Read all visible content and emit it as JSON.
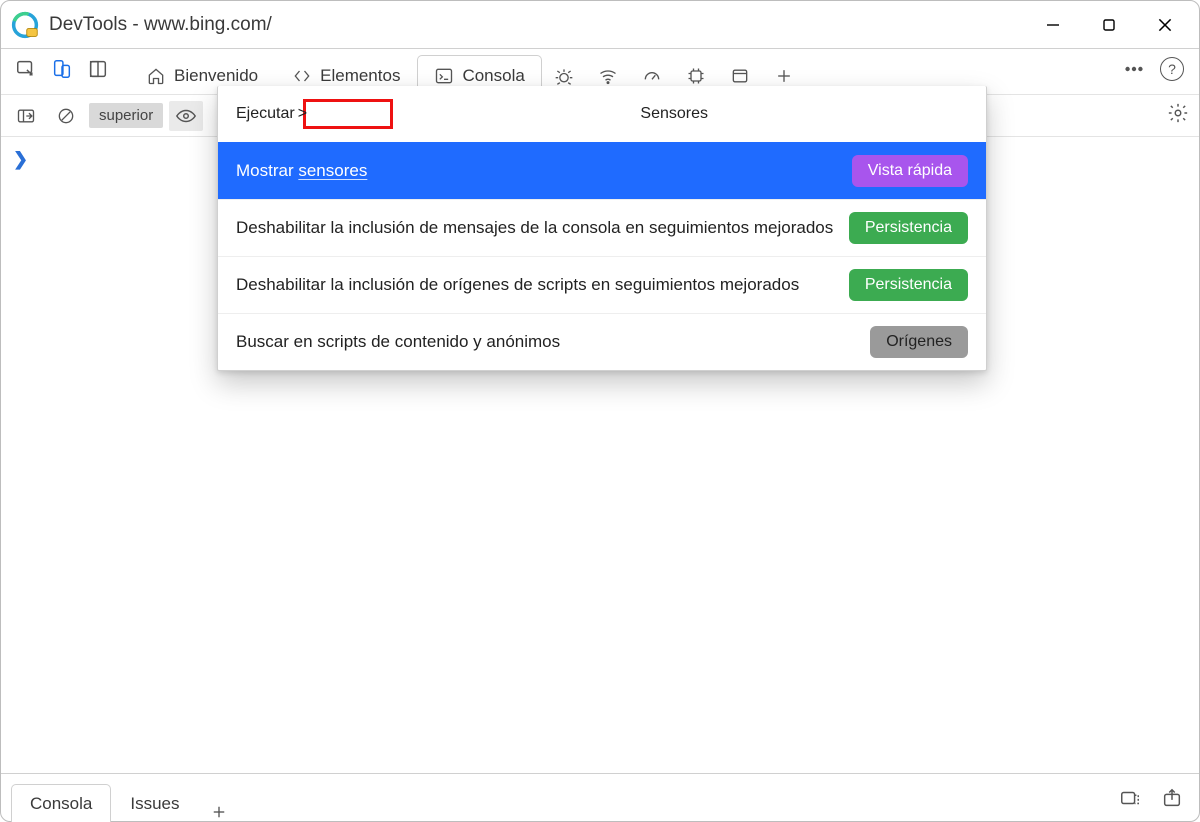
{
  "window": {
    "title": "DevTools - www.bing.com/"
  },
  "main_tabs": {
    "welcome": "Bienvenido",
    "elements": "Elementos",
    "console": "Consola"
  },
  "console_toolbar": {
    "scope": "superior"
  },
  "palette": {
    "run_label": "Ejecutar",
    "query": "Sensores",
    "items": [
      {
        "label_pre": "Mostrar ",
        "label_match": "sensores",
        "badge": "Vista rápida",
        "badge_class": "b-purple"
      },
      {
        "label": "Deshabilitar la inclusión de mensajes de la consola en seguimientos mejorados",
        "badge": "Persistencia",
        "badge_class": "b-green"
      },
      {
        "label": "Deshabilitar la inclusión de orígenes de scripts en seguimientos mejorados",
        "badge": "Persistencia",
        "badge_class": "b-green"
      },
      {
        "label": "Buscar en scripts de contenido y anónimos",
        "badge": "Orígenes",
        "badge_class": "b-gray"
      }
    ]
  },
  "drawer": {
    "console": "Consola",
    "issues": "Issues"
  }
}
